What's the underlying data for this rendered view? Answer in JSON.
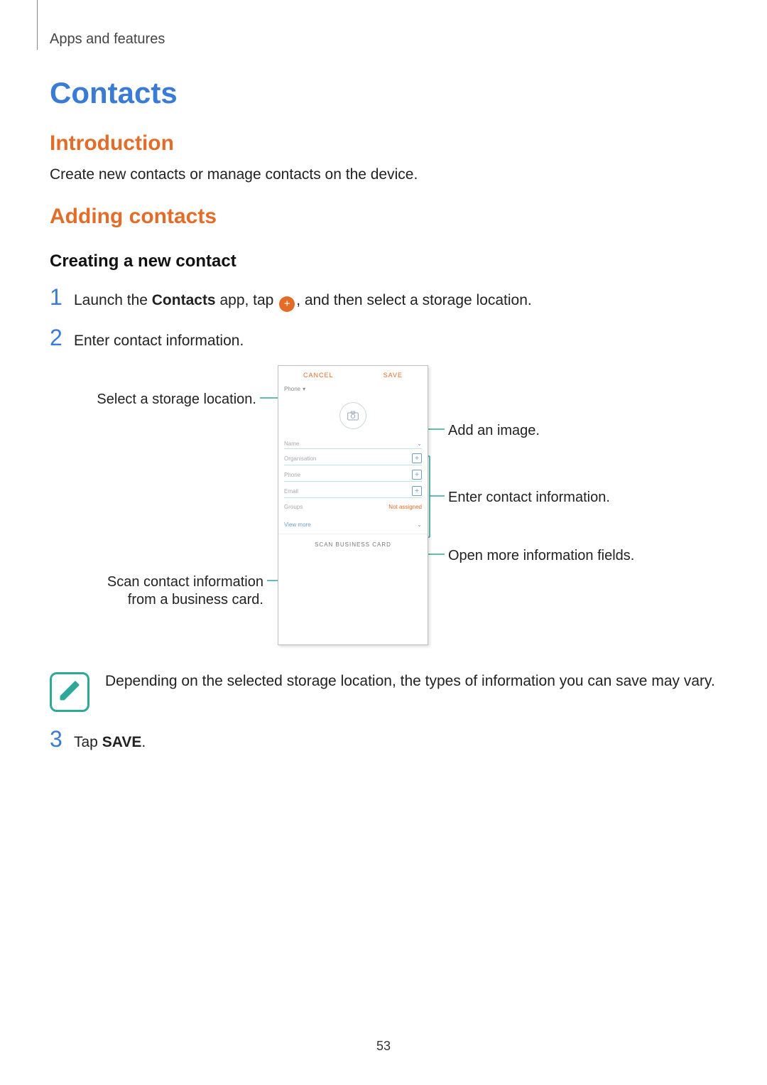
{
  "breadcrumb": "Apps and features",
  "title": "Contacts",
  "intro_heading": "Introduction",
  "intro_body": "Create new contacts or manage contacts on the device.",
  "adding_heading": "Adding contacts",
  "creating_heading": "Creating a new contact",
  "steps": {
    "n1": "1",
    "s1a": "Launch the ",
    "s1b": "Contacts",
    "s1c": " app, tap ",
    "s1d": ", and then select a storage location.",
    "n2": "2",
    "s2": "Enter contact information.",
    "n3": "3",
    "s3a": "Tap ",
    "s3b": "SAVE",
    "s3c": "."
  },
  "shot": {
    "cancel": "CANCEL",
    "save": "SAVE",
    "storage": "Phone",
    "fields": {
      "name": "Name",
      "org": "Organisation",
      "phone": "Phone",
      "email": "Email",
      "groups": "Groups",
      "not_assigned": "Not assigned",
      "view_more": "View more",
      "scan": "SCAN BUSINESS CARD"
    }
  },
  "callouts": {
    "storage": "Select a storage location.",
    "scan": "Scan contact information from a business card.",
    "image": "Add an image.",
    "info": "Enter contact information.",
    "more": "Open more information fields."
  },
  "note": "Depending on the selected storage location, the types of information you can save may vary.",
  "page_number": "53"
}
